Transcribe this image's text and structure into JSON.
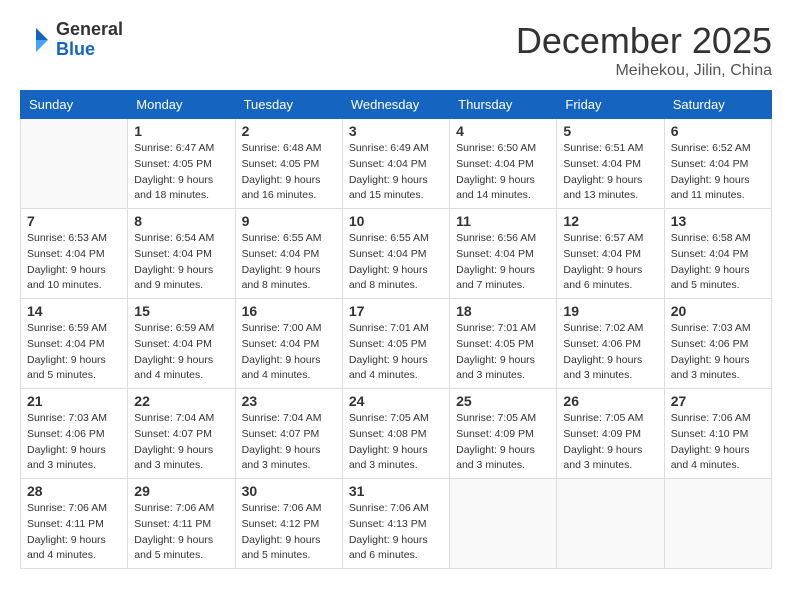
{
  "logo": {
    "general": "General",
    "blue": "Blue"
  },
  "title": {
    "month": "December 2025",
    "location": "Meihekou, Jilin, China"
  },
  "weekdays": [
    "Sunday",
    "Monday",
    "Tuesday",
    "Wednesday",
    "Thursday",
    "Friday",
    "Saturday"
  ],
  "weeks": [
    [
      {
        "day": "",
        "info": ""
      },
      {
        "day": "1",
        "info": "Sunrise: 6:47 AM\nSunset: 4:05 PM\nDaylight: 9 hours\nand 18 minutes."
      },
      {
        "day": "2",
        "info": "Sunrise: 6:48 AM\nSunset: 4:05 PM\nDaylight: 9 hours\nand 16 minutes."
      },
      {
        "day": "3",
        "info": "Sunrise: 6:49 AM\nSunset: 4:04 PM\nDaylight: 9 hours\nand 15 minutes."
      },
      {
        "day": "4",
        "info": "Sunrise: 6:50 AM\nSunset: 4:04 PM\nDaylight: 9 hours\nand 14 minutes."
      },
      {
        "day": "5",
        "info": "Sunrise: 6:51 AM\nSunset: 4:04 PM\nDaylight: 9 hours\nand 13 minutes."
      },
      {
        "day": "6",
        "info": "Sunrise: 6:52 AM\nSunset: 4:04 PM\nDaylight: 9 hours\nand 11 minutes."
      }
    ],
    [
      {
        "day": "7",
        "info": "Sunrise: 6:53 AM\nSunset: 4:04 PM\nDaylight: 9 hours\nand 10 minutes."
      },
      {
        "day": "8",
        "info": "Sunrise: 6:54 AM\nSunset: 4:04 PM\nDaylight: 9 hours\nand 9 minutes."
      },
      {
        "day": "9",
        "info": "Sunrise: 6:55 AM\nSunset: 4:04 PM\nDaylight: 9 hours\nand 8 minutes."
      },
      {
        "day": "10",
        "info": "Sunrise: 6:55 AM\nSunset: 4:04 PM\nDaylight: 9 hours\nand 8 minutes."
      },
      {
        "day": "11",
        "info": "Sunrise: 6:56 AM\nSunset: 4:04 PM\nDaylight: 9 hours\nand 7 minutes."
      },
      {
        "day": "12",
        "info": "Sunrise: 6:57 AM\nSunset: 4:04 PM\nDaylight: 9 hours\nand 6 minutes."
      },
      {
        "day": "13",
        "info": "Sunrise: 6:58 AM\nSunset: 4:04 PM\nDaylight: 9 hours\nand 5 minutes."
      }
    ],
    [
      {
        "day": "14",
        "info": "Sunrise: 6:59 AM\nSunset: 4:04 PM\nDaylight: 9 hours\nand 5 minutes."
      },
      {
        "day": "15",
        "info": "Sunrise: 6:59 AM\nSunset: 4:04 PM\nDaylight: 9 hours\nand 4 minutes."
      },
      {
        "day": "16",
        "info": "Sunrise: 7:00 AM\nSunset: 4:04 PM\nDaylight: 9 hours\nand 4 minutes."
      },
      {
        "day": "17",
        "info": "Sunrise: 7:01 AM\nSunset: 4:05 PM\nDaylight: 9 hours\nand 4 minutes."
      },
      {
        "day": "18",
        "info": "Sunrise: 7:01 AM\nSunset: 4:05 PM\nDaylight: 9 hours\nand 3 minutes."
      },
      {
        "day": "19",
        "info": "Sunrise: 7:02 AM\nSunset: 4:06 PM\nDaylight: 9 hours\nand 3 minutes."
      },
      {
        "day": "20",
        "info": "Sunrise: 7:03 AM\nSunset: 4:06 PM\nDaylight: 9 hours\nand 3 minutes."
      }
    ],
    [
      {
        "day": "21",
        "info": "Sunrise: 7:03 AM\nSunset: 4:06 PM\nDaylight: 9 hours\nand 3 minutes."
      },
      {
        "day": "22",
        "info": "Sunrise: 7:04 AM\nSunset: 4:07 PM\nDaylight: 9 hours\nand 3 minutes."
      },
      {
        "day": "23",
        "info": "Sunrise: 7:04 AM\nSunset: 4:07 PM\nDaylight: 9 hours\nand 3 minutes."
      },
      {
        "day": "24",
        "info": "Sunrise: 7:05 AM\nSunset: 4:08 PM\nDaylight: 9 hours\nand 3 minutes."
      },
      {
        "day": "25",
        "info": "Sunrise: 7:05 AM\nSunset: 4:09 PM\nDaylight: 9 hours\nand 3 minutes."
      },
      {
        "day": "26",
        "info": "Sunrise: 7:05 AM\nSunset: 4:09 PM\nDaylight: 9 hours\nand 3 minutes."
      },
      {
        "day": "27",
        "info": "Sunrise: 7:06 AM\nSunset: 4:10 PM\nDaylight: 9 hours\nand 4 minutes."
      }
    ],
    [
      {
        "day": "28",
        "info": "Sunrise: 7:06 AM\nSunset: 4:11 PM\nDaylight: 9 hours\nand 4 minutes."
      },
      {
        "day": "29",
        "info": "Sunrise: 7:06 AM\nSunset: 4:11 PM\nDaylight: 9 hours\nand 5 minutes."
      },
      {
        "day": "30",
        "info": "Sunrise: 7:06 AM\nSunset: 4:12 PM\nDaylight: 9 hours\nand 5 minutes."
      },
      {
        "day": "31",
        "info": "Sunrise: 7:06 AM\nSunset: 4:13 PM\nDaylight: 9 hours\nand 6 minutes."
      },
      {
        "day": "",
        "info": ""
      },
      {
        "day": "",
        "info": ""
      },
      {
        "day": "",
        "info": ""
      }
    ]
  ]
}
